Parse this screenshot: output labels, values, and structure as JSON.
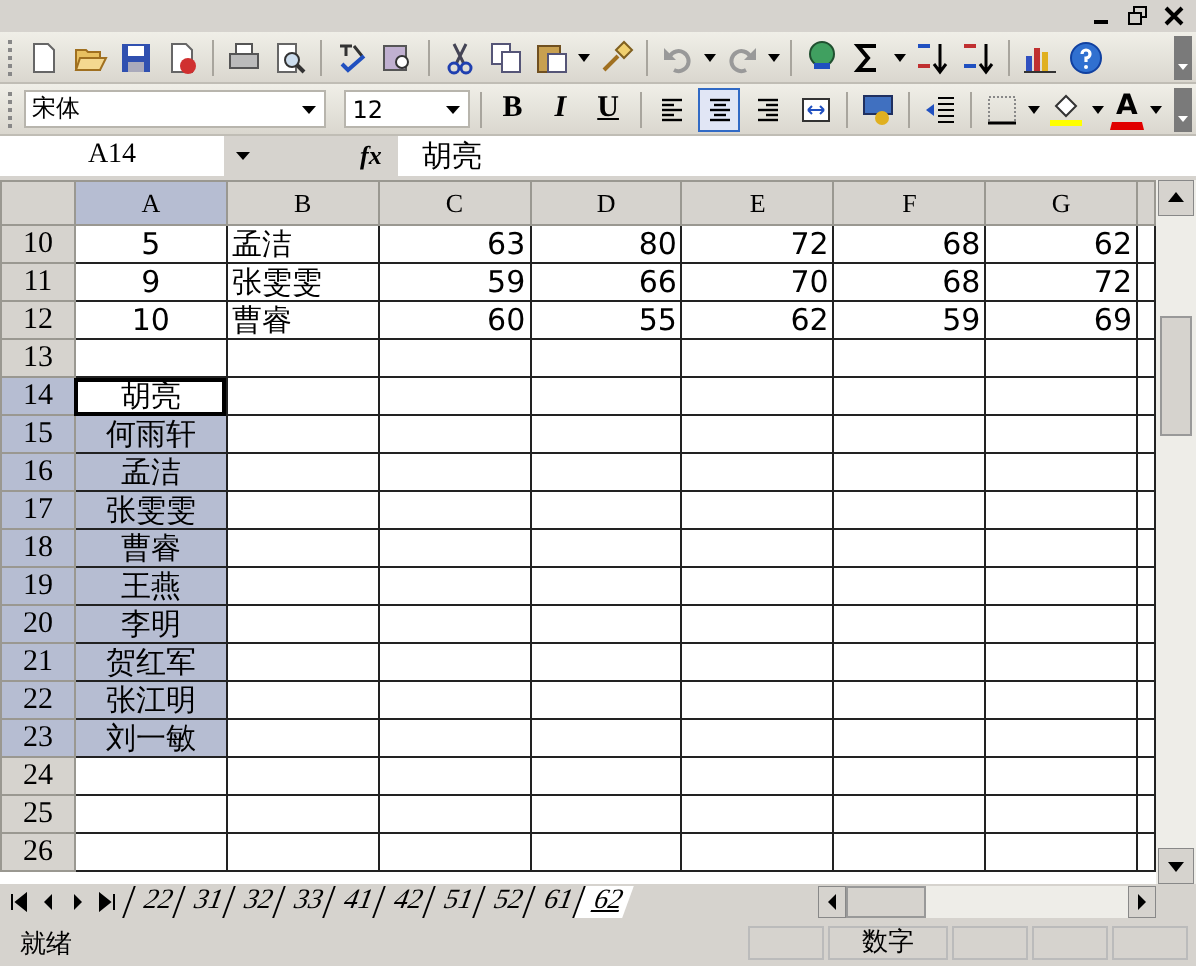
{
  "format_toolbar": {
    "font": "宋体",
    "size": "12",
    "style_buttons": [
      {
        "kind": "bold",
        "label": "B"
      },
      {
        "kind": "italic",
        "label": "I"
      },
      {
        "kind": "underline",
        "label": "U"
      }
    ],
    "align_buttons": [
      {
        "kind": "left",
        "selected": false
      },
      {
        "kind": "center",
        "selected": true
      },
      {
        "kind": "right",
        "selected": false
      },
      {
        "kind": "merge",
        "selected": false
      }
    ],
    "font_color_label": "A"
  },
  "formula_bar": {
    "name_box": "A14",
    "fx": "fx",
    "value": "胡亮"
  },
  "sheet": {
    "columns": [
      {
        "label": "A",
        "selected": true
      },
      {
        "label": "B",
        "selected": false
      },
      {
        "label": "C",
        "selected": false
      },
      {
        "label": "D",
        "selected": false
      },
      {
        "label": "E",
        "selected": false
      },
      {
        "label": "F",
        "selected": false
      },
      {
        "label": "G",
        "selected": false
      }
    ],
    "rows": [
      {
        "header": "10",
        "selected": false,
        "active": false,
        "cells": [
          "5",
          "孟洁",
          "63",
          "80",
          "72",
          "68",
          "62"
        ]
      },
      {
        "header": "11",
        "selected": false,
        "active": false,
        "cells": [
          "9",
          "张雯雯",
          "59",
          "66",
          "70",
          "68",
          "72"
        ]
      },
      {
        "header": "12",
        "selected": false,
        "active": false,
        "cells": [
          "10",
          "曹睿",
          "60",
          "55",
          "62",
          "59",
          "69"
        ]
      },
      {
        "header": "13",
        "selected": false,
        "active": false,
        "cells": []
      },
      {
        "header": "14",
        "selected": true,
        "active": true,
        "cells": [
          "胡亮"
        ]
      },
      {
        "header": "15",
        "selected": true,
        "active": false,
        "cells": [
          "何雨轩"
        ]
      },
      {
        "header": "16",
        "selected": true,
        "active": false,
        "cells": [
          "孟洁"
        ]
      },
      {
        "header": "17",
        "selected": true,
        "active": false,
        "cells": [
          "张雯雯"
        ]
      },
      {
        "header": "18",
        "selected": true,
        "active": false,
        "cells": [
          "曹睿"
        ]
      },
      {
        "header": "19",
        "selected": true,
        "active": false,
        "cells": [
          "王燕"
        ]
      },
      {
        "header": "20",
        "selected": true,
        "active": false,
        "cells": [
          "李明"
        ]
      },
      {
        "header": "21",
        "selected": true,
        "active": false,
        "cells": [
          "贺红军"
        ]
      },
      {
        "header": "22",
        "selected": true,
        "active": false,
        "cells": [
          "张江明"
        ]
      },
      {
        "header": "23",
        "selected": true,
        "active": false,
        "cells": [
          "刘一敏"
        ]
      },
      {
        "header": "24",
        "selected": false,
        "active": false,
        "cells": []
      },
      {
        "header": "25",
        "selected": false,
        "active": false,
        "cells": []
      },
      {
        "header": "26",
        "selected": false,
        "active": false,
        "cells": []
      }
    ]
  },
  "sheet_tabs": [
    {
      "label": "22",
      "selected": false
    },
    {
      "label": "31",
      "selected": false
    },
    {
      "label": "32",
      "selected": false
    },
    {
      "label": "33",
      "selected": false
    },
    {
      "label": "41",
      "selected": false
    },
    {
      "label": "42",
      "selected": false
    },
    {
      "label": "51",
      "selected": false
    },
    {
      "label": "52",
      "selected": false
    },
    {
      "label": "61",
      "selected": false
    },
    {
      "label": "62",
      "selected": true
    }
  ],
  "status_bar": {
    "state": "就绪",
    "mode": "数字"
  }
}
